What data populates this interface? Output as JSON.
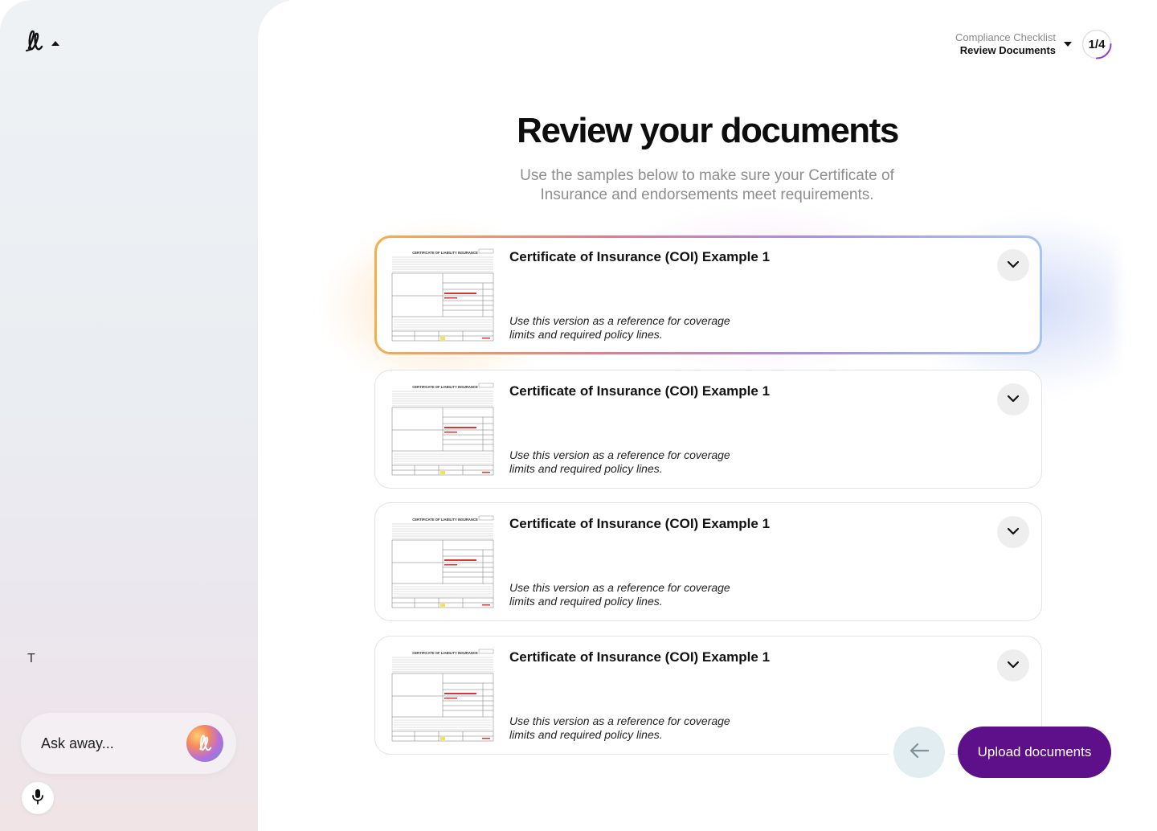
{
  "sidebar": {
    "initial": "T",
    "ask_placeholder": "Ask away..."
  },
  "header": {
    "section": "Compliance Checklist",
    "step": "Review Documents",
    "progress_text": "1/4",
    "progress_fraction": 0.25
  },
  "main": {
    "title": "Review your documents",
    "subtitle": "Use the samples below to make sure your Certificate of Insurance and endorsements meet requirements.",
    "cards": [
      {
        "title": "Certificate of Insurance (COI) Example 1",
        "description": "Use this version as a reference for coverage limits and required policy lines.",
        "thumb_heading": "CERTIFICATE OF LIABILITY INSURANCE"
      },
      {
        "title": "Certificate of Insurance (COI) Example 1",
        "description": "Use this version as a reference for coverage limits and required policy lines.",
        "thumb_heading": "CERTIFICATE OF LIABILITY INSURANCE"
      },
      {
        "title": "Certificate of Insurance (COI) Example 1",
        "description": "Use this version as a reference for coverage limits and required policy lines.",
        "thumb_heading": "CERTIFICATE OF LIABILITY INSURANCE"
      },
      {
        "title": "Certificate of Insurance (COI) Example 1",
        "description": "Use this version as a reference for coverage limits and required policy lines.",
        "thumb_heading": "CERTIFICATE OF LIABILITY INSURANCE"
      }
    ]
  },
  "footer": {
    "upload_label": "Upload documents"
  },
  "icons": {
    "logo": "signature-logo-icon",
    "chevron": "chevron-down-icon",
    "back": "arrow-left-icon",
    "mic": "microphone-icon"
  },
  "colors": {
    "primary": "#5e0f8a",
    "back_button": "#e2edf1",
    "muted_text": "#8e8e8e"
  }
}
